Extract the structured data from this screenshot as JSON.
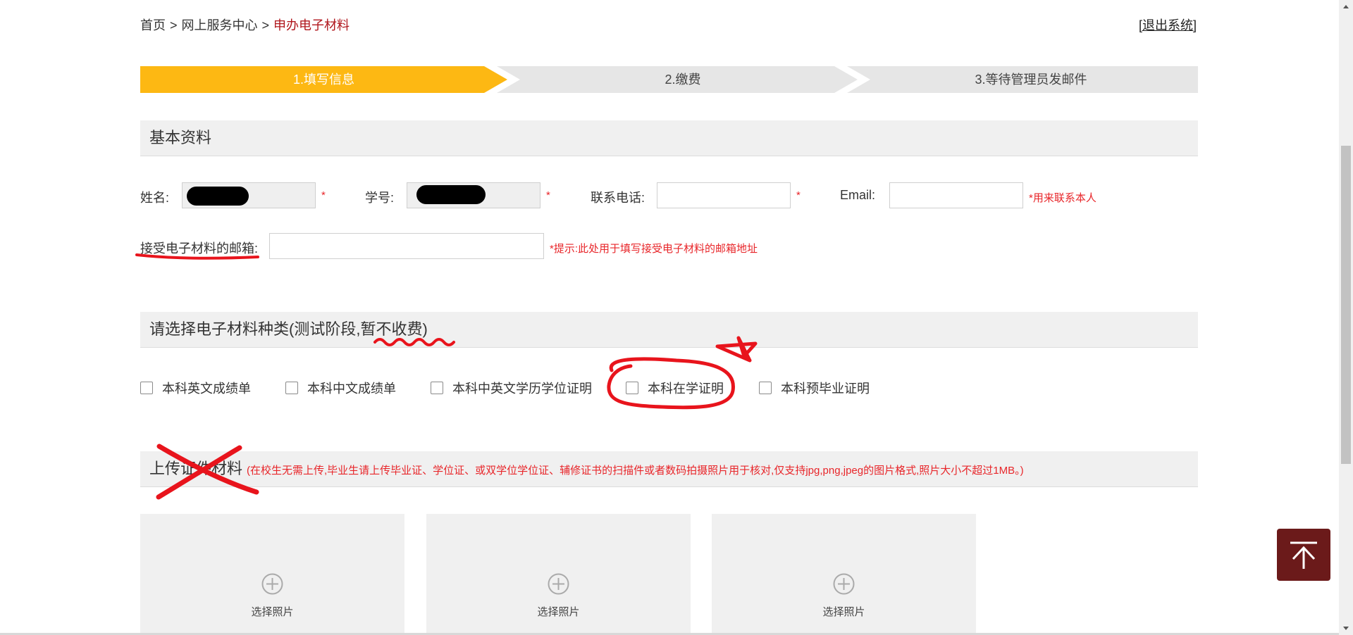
{
  "breadcrumb": {
    "home": "首页",
    "service_center": "网上服务中心",
    "current": "申办电子材料",
    "separator": ">"
  },
  "header": {
    "logout": "[退出系统]"
  },
  "steps": [
    {
      "label": "1.填写信息",
      "state": "active"
    },
    {
      "label": "2.缴费",
      "state": "pending"
    },
    {
      "label": "3.等待管理员发邮件",
      "state": "pending"
    }
  ],
  "basic_info": {
    "title": "基本资料",
    "name_label": "姓名:",
    "student_id_label": "学号:",
    "phone_label": "联系电话:",
    "email_label": "Email:",
    "required_mark": "*",
    "email_hint": "*用来联系本人",
    "recv_email_label": "接受电子材料的邮箱:",
    "recv_email_hint": "*提示:此处用于填写接受电子材料的邮箱地址"
  },
  "material_types": {
    "title": "请选择电子材料种类(测试阶段,暂不收费)",
    "options": [
      {
        "label": "本科英文成绩单",
        "checked": false
      },
      {
        "label": "本科中文成绩单",
        "checked": false
      },
      {
        "label": "本科中英文学历学位证明",
        "checked": false
      },
      {
        "label": "本科在学证明",
        "checked": false
      },
      {
        "label": "本科预毕业证明",
        "checked": false
      }
    ]
  },
  "upload": {
    "title": "上传证件材料",
    "note": "(在校生无需上传,毕业生请上传毕业证、学位证、或双学位学位证、辅修证书的扫描件或者数码拍摄照片用于核对,仅支持jpg,png,jpeg的图片格式,照片大小不超过1MB。)",
    "slots": [
      {
        "label": "选择照片",
        "icon": "plus-circle-icon"
      },
      {
        "label": "选择照片",
        "icon": "plus-circle-icon"
      },
      {
        "label": "选择照片",
        "icon": "plus-circle-icon"
      }
    ]
  },
  "back_to_top": {
    "icon": "arrow-up-to-top-icon"
  },
  "colors": {
    "accent": "#fdb813",
    "brand": "#6b1a1a",
    "alert": "#e8262a",
    "breadcrumb_current": "#b0161c",
    "annotation": "#e8141c"
  }
}
